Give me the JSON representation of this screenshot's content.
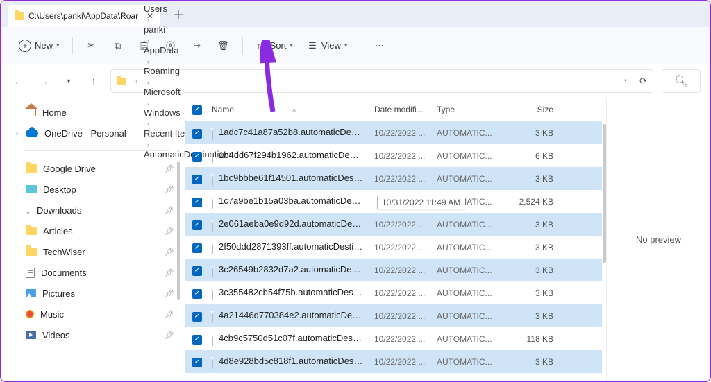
{
  "tab": {
    "title": "C:\\Users\\panki\\AppData\\Roar"
  },
  "toolbar": {
    "new": "New",
    "sort": "Sort",
    "view": "View"
  },
  "breadcrumbs": [
    "Users",
    "panki",
    "AppData",
    "Roaming",
    "Microsoft",
    "Windows",
    "Recent Items",
    "AutomaticDestinations"
  ],
  "sidebar": {
    "home": "Home",
    "onedrive": "OneDrive - Personal",
    "pins": [
      "Google Drive",
      "Desktop",
      "Downloads",
      "Articles",
      "TechWiser",
      "Documents",
      "Pictures",
      "Music",
      "Videos"
    ]
  },
  "columns": {
    "name": "Name",
    "date": "Date modifi...",
    "type": "Type",
    "size": "Size"
  },
  "files": [
    {
      "name": "1adc7c41a87a52b8.automaticDestinati...",
      "date": "10/22/2022 ...",
      "type": "AUTOMATIC...",
      "size": "3 KB",
      "sel": true
    },
    {
      "name": "1b4dd67f294b1962.automaticDestinati...",
      "date": "10/22/2022 ...",
      "type": "AUTOMATIC...",
      "size": "6 KB",
      "sel": false
    },
    {
      "name": "1bc9bbbe61f14501.automaticDestinati...",
      "date": "10/22/2022 ...",
      "type": "AUTOMATIC...",
      "size": "3 KB",
      "sel": true
    },
    {
      "name": "1c7a9be1b15a03ba.automaticDestinati...",
      "date": "10/31/2022 11:49 AM",
      "type": "AUTOMATIC...",
      "size": "2,524 KB",
      "sel": false,
      "tip": true
    },
    {
      "name": "2e061aeba0e9d92d.automaticDestinati...",
      "date": "10/22/2022 ...",
      "type": "AUTOMATIC...",
      "size": "3 KB",
      "sel": true
    },
    {
      "name": "2f50ddd2871393ff.automaticDestinatio...",
      "date": "10/22/2022 ...",
      "type": "AUTOMATIC...",
      "size": "3 KB",
      "sel": false
    },
    {
      "name": "3c26549b2832d7a2.automaticDestinati...",
      "date": "10/22/2022 ...",
      "type": "AUTOMATIC...",
      "size": "3 KB",
      "sel": true
    },
    {
      "name": "3c355482cb54f75b.automaticDestinati...",
      "date": "10/22/2022 ...",
      "type": "AUTOMATIC...",
      "size": "3 KB",
      "sel": false
    },
    {
      "name": "4a21446d770384e2.automaticDestinati...",
      "date": "10/22/2022 ...",
      "type": "AUTOMATIC...",
      "size": "3 KB",
      "sel": true
    },
    {
      "name": "4cb9c5750d51c07f.automaticDestinati...",
      "date": "10/22/2022 ...",
      "type": "AUTOMATIC...",
      "size": "118 KB",
      "sel": false
    },
    {
      "name": "4d8e928bd5c818f1.automaticDestinati...",
      "date": "10/22/2022 ...",
      "type": "AUTOMATIC...",
      "size": "3 KB",
      "sel": true
    }
  ],
  "tooltip": "10/31/2022 11:49 AM",
  "preview": "No preview"
}
